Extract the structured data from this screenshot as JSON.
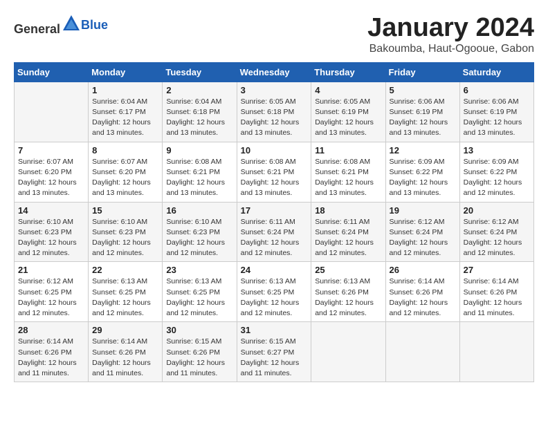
{
  "header": {
    "logo_general": "General",
    "logo_blue": "Blue",
    "month": "January 2024",
    "location": "Bakoumba, Haut-Ogooue, Gabon"
  },
  "days_of_week": [
    "Sunday",
    "Monday",
    "Tuesday",
    "Wednesday",
    "Thursday",
    "Friday",
    "Saturday"
  ],
  "weeks": [
    [
      {
        "day": "",
        "info": ""
      },
      {
        "day": "1",
        "info": "Sunrise: 6:04 AM\nSunset: 6:17 PM\nDaylight: 12 hours\nand 13 minutes."
      },
      {
        "day": "2",
        "info": "Sunrise: 6:04 AM\nSunset: 6:18 PM\nDaylight: 12 hours\nand 13 minutes."
      },
      {
        "day": "3",
        "info": "Sunrise: 6:05 AM\nSunset: 6:18 PM\nDaylight: 12 hours\nand 13 minutes."
      },
      {
        "day": "4",
        "info": "Sunrise: 6:05 AM\nSunset: 6:19 PM\nDaylight: 12 hours\nand 13 minutes."
      },
      {
        "day": "5",
        "info": "Sunrise: 6:06 AM\nSunset: 6:19 PM\nDaylight: 12 hours\nand 13 minutes."
      },
      {
        "day": "6",
        "info": "Sunrise: 6:06 AM\nSunset: 6:19 PM\nDaylight: 12 hours\nand 13 minutes."
      }
    ],
    [
      {
        "day": "7",
        "info": "Sunrise: 6:07 AM\nSunset: 6:20 PM\nDaylight: 12 hours\nand 13 minutes."
      },
      {
        "day": "8",
        "info": "Sunrise: 6:07 AM\nSunset: 6:20 PM\nDaylight: 12 hours\nand 13 minutes."
      },
      {
        "day": "9",
        "info": "Sunrise: 6:08 AM\nSunset: 6:21 PM\nDaylight: 12 hours\nand 13 minutes."
      },
      {
        "day": "10",
        "info": "Sunrise: 6:08 AM\nSunset: 6:21 PM\nDaylight: 12 hours\nand 13 minutes."
      },
      {
        "day": "11",
        "info": "Sunrise: 6:08 AM\nSunset: 6:21 PM\nDaylight: 12 hours\nand 13 minutes."
      },
      {
        "day": "12",
        "info": "Sunrise: 6:09 AM\nSunset: 6:22 PM\nDaylight: 12 hours\nand 13 minutes."
      },
      {
        "day": "13",
        "info": "Sunrise: 6:09 AM\nSunset: 6:22 PM\nDaylight: 12 hours\nand 12 minutes."
      }
    ],
    [
      {
        "day": "14",
        "info": "Sunrise: 6:10 AM\nSunset: 6:23 PM\nDaylight: 12 hours\nand 12 minutes."
      },
      {
        "day": "15",
        "info": "Sunrise: 6:10 AM\nSunset: 6:23 PM\nDaylight: 12 hours\nand 12 minutes."
      },
      {
        "day": "16",
        "info": "Sunrise: 6:10 AM\nSunset: 6:23 PM\nDaylight: 12 hours\nand 12 minutes."
      },
      {
        "day": "17",
        "info": "Sunrise: 6:11 AM\nSunset: 6:24 PM\nDaylight: 12 hours\nand 12 minutes."
      },
      {
        "day": "18",
        "info": "Sunrise: 6:11 AM\nSunset: 6:24 PM\nDaylight: 12 hours\nand 12 minutes."
      },
      {
        "day": "19",
        "info": "Sunrise: 6:12 AM\nSunset: 6:24 PM\nDaylight: 12 hours\nand 12 minutes."
      },
      {
        "day": "20",
        "info": "Sunrise: 6:12 AM\nSunset: 6:24 PM\nDaylight: 12 hours\nand 12 minutes."
      }
    ],
    [
      {
        "day": "21",
        "info": "Sunrise: 6:12 AM\nSunset: 6:25 PM\nDaylight: 12 hours\nand 12 minutes."
      },
      {
        "day": "22",
        "info": "Sunrise: 6:13 AM\nSunset: 6:25 PM\nDaylight: 12 hours\nand 12 minutes."
      },
      {
        "day": "23",
        "info": "Sunrise: 6:13 AM\nSunset: 6:25 PM\nDaylight: 12 hours\nand 12 minutes."
      },
      {
        "day": "24",
        "info": "Sunrise: 6:13 AM\nSunset: 6:25 PM\nDaylight: 12 hours\nand 12 minutes."
      },
      {
        "day": "25",
        "info": "Sunrise: 6:13 AM\nSunset: 6:26 PM\nDaylight: 12 hours\nand 12 minutes."
      },
      {
        "day": "26",
        "info": "Sunrise: 6:14 AM\nSunset: 6:26 PM\nDaylight: 12 hours\nand 12 minutes."
      },
      {
        "day": "27",
        "info": "Sunrise: 6:14 AM\nSunset: 6:26 PM\nDaylight: 12 hours\nand 11 minutes."
      }
    ],
    [
      {
        "day": "28",
        "info": "Sunrise: 6:14 AM\nSunset: 6:26 PM\nDaylight: 12 hours\nand 11 minutes."
      },
      {
        "day": "29",
        "info": "Sunrise: 6:14 AM\nSunset: 6:26 PM\nDaylight: 12 hours\nand 11 minutes."
      },
      {
        "day": "30",
        "info": "Sunrise: 6:15 AM\nSunset: 6:26 PM\nDaylight: 12 hours\nand 11 minutes."
      },
      {
        "day": "31",
        "info": "Sunrise: 6:15 AM\nSunset: 6:27 PM\nDaylight: 12 hours\nand 11 minutes."
      },
      {
        "day": "",
        "info": ""
      },
      {
        "day": "",
        "info": ""
      },
      {
        "day": "",
        "info": ""
      }
    ]
  ]
}
